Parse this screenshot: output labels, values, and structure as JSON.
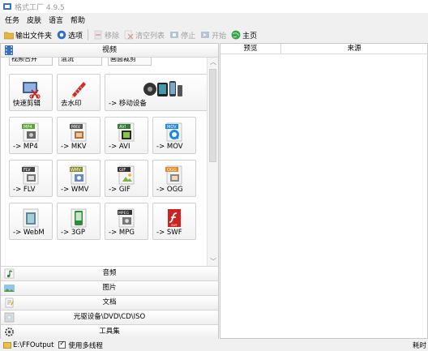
{
  "window": {
    "title": "格式工厂 4.9.5"
  },
  "menu": {
    "items": [
      "任务",
      "皮肤",
      "语言",
      "帮助"
    ]
  },
  "toolbar": {
    "output_folder": "输出文件夹",
    "options": "选项",
    "remove": "移除",
    "clear_list": "清空列表",
    "stop": "停止",
    "start": "开始",
    "home": "主页"
  },
  "video_panel": {
    "header": "视频",
    "partial_tiles": [
      "视频合并",
      "混流",
      "画面裁剪"
    ],
    "tiles": [
      {
        "label": "快速剪辑",
        "icon": "quick-clip-icon"
      },
      {
        "label": "去水印",
        "icon": "remove-watermark-icon"
      },
      {
        "label": "-> 移动设备",
        "icon": "mobile-device-icon"
      },
      {
        "label": "-> MP4",
        "icon": "mp4-icon",
        "badge": "MP4",
        "badge_color": "#5aa52e"
      },
      {
        "label": "-> MKV",
        "icon": "mkv-icon",
        "badge": "MKV",
        "badge_color": "#555555"
      },
      {
        "label": "-> AVI",
        "icon": "avi-icon",
        "badge": "AVI",
        "badge_color": "#2e7d32"
      },
      {
        "label": "-> MOV",
        "icon": "mov-icon",
        "badge": "MOV",
        "badge_color": "#1e88e5"
      },
      {
        "label": "-> FLV",
        "icon": "flv-icon",
        "badge": "FLV",
        "badge_color": "#444444"
      },
      {
        "label": "-> WMV",
        "icon": "wmv-icon",
        "badge": "WMV",
        "badge_color": "#8a8a2e"
      },
      {
        "label": "-> GIF",
        "icon": "gif-icon",
        "badge": "GIF",
        "badge_color": "#333333"
      },
      {
        "label": "-> OGG",
        "icon": "ogg-icon",
        "badge": "OGG",
        "badge_color": "#e08a2a"
      },
      {
        "label": "-> WebM",
        "icon": "webm-icon",
        "badge": "",
        "badge_color": "#5a8a9a"
      },
      {
        "label": "-> 3GP",
        "icon": "3gp-icon",
        "badge": "3GP",
        "badge_color": "#2e8b3a"
      },
      {
        "label": "-> MPG",
        "icon": "mpg-icon",
        "badge": "MPEG",
        "badge_color": "#333333"
      },
      {
        "label": "-> SWF",
        "icon": "swf-icon",
        "badge": "SWF",
        "badge_color": "#cc2222"
      }
    ]
  },
  "categories": [
    {
      "label": "音频",
      "icon": "audio-icon"
    },
    {
      "label": "图片",
      "icon": "picture-icon"
    },
    {
      "label": "文档",
      "icon": "document-icon"
    },
    {
      "label": "光驱设备\\DVD\\CD\\ISO",
      "icon": "disc-icon"
    },
    {
      "label": "工具集",
      "icon": "toolbox-icon"
    }
  ],
  "task_list": {
    "columns": [
      "预览",
      "来源"
    ]
  },
  "status": {
    "output_path": "E:\\FFOutput",
    "multithread": "使用多线程",
    "right_text": "耗时"
  }
}
